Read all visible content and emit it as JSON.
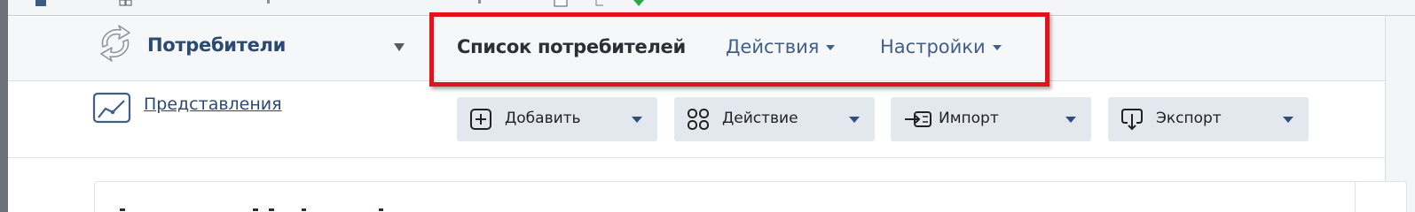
{
  "app": {
    "title": "Потребители",
    "logo_icon": "recycle-arrows-icon"
  },
  "tabs": [
    {
      "label": "Список потребителей",
      "active": true
    },
    {
      "label": "Действия",
      "has_dropdown": true
    },
    {
      "label": "Настройки",
      "has_dropdown": true
    }
  ],
  "views": {
    "label": "Представления",
    "icon": "chart-window-icon"
  },
  "toolbar": [
    {
      "label": "Добавить",
      "icon": "plus-square-icon"
    },
    {
      "label": "Действие",
      "icon": "four-circles-icon"
    },
    {
      "label": "Импорт",
      "icon": "import-icon"
    },
    {
      "label": "Экспорт",
      "icon": "export-icon"
    }
  ],
  "colors": {
    "accent_text": "#2a4a73",
    "link": "#3f5f8a",
    "highlight_border": "#e3121b",
    "button_bg": "#e3e8ee",
    "header_bg": "#f6f7f9"
  }
}
